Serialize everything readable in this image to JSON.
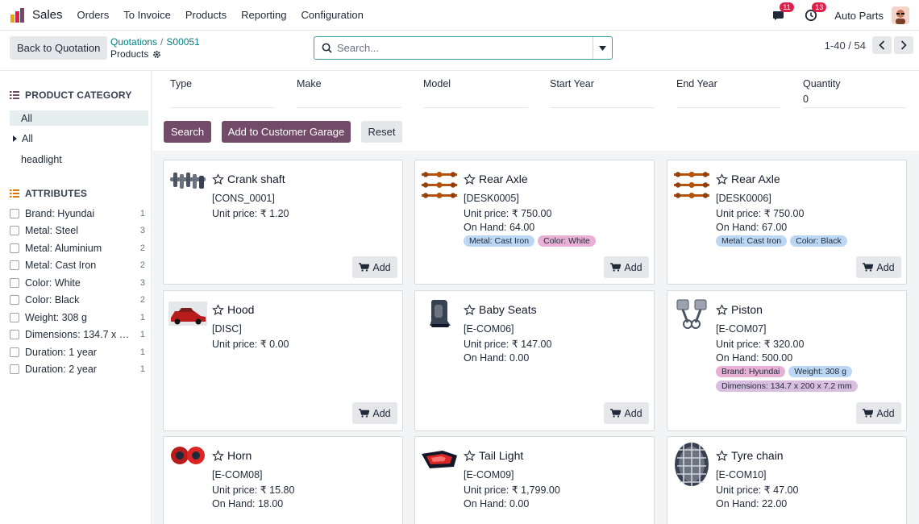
{
  "navbar": {
    "app_name": "Sales",
    "menu": [
      "Orders",
      "To Invoice",
      "Products",
      "Reporting",
      "Configuration"
    ],
    "messages_count": "11",
    "activities_count": "13",
    "company": "Auto Parts"
  },
  "control": {
    "back_label": "Back to Quotation",
    "breadcrumb_root": "Quotations",
    "breadcrumb_sep": "/",
    "breadcrumb_record": "S00051",
    "breadcrumb_current": "Products",
    "search_placeholder": "Search...",
    "pager": "1-40 / 54"
  },
  "sidebar": {
    "category_title": "PRODUCT CATEGORY",
    "categories": [
      "All",
      "All",
      "headlight"
    ],
    "attributes_title": "ATTRIBUTES",
    "attributes": [
      {
        "label": "Brand: Hyundai",
        "count": "1"
      },
      {
        "label": "Metal: Steel",
        "count": "3"
      },
      {
        "label": "Metal: Aluminium",
        "count": "2"
      },
      {
        "label": "Metal: Cast Iron",
        "count": "2"
      },
      {
        "label": "Color: White",
        "count": "3"
      },
      {
        "label": "Color: Black",
        "count": "2"
      },
      {
        "label": "Weight: 308 g",
        "count": "1"
      },
      {
        "label": "Dimensions: 134.7 x 200 x 7.2 mm",
        "count": "1"
      },
      {
        "label": "Duration: 1 year",
        "count": "1"
      },
      {
        "label": "Duration: 2 year",
        "count": "1"
      }
    ]
  },
  "filters": {
    "labels": [
      "Type",
      "Make",
      "Model",
      "Start Year",
      "End Year",
      "Quantity"
    ],
    "quantity_value": "0",
    "search_button": "Search",
    "garage_button": "Add to Customer Garage",
    "reset_button": "Reset"
  },
  "products": [
    {
      "name": "Crank shaft",
      "code": "[CONS_0001]",
      "price": "Unit price: ₹ 1.20",
      "onhand": "",
      "tags": [],
      "add": "Add"
    },
    {
      "name": "Rear Axle",
      "code": "[DESK0005]",
      "price": "Unit price: ₹ 750.00",
      "onhand": "On Hand: 64.00",
      "tags": [
        {
          "label": "Metal: Cast Iron",
          "color": "#bcd7f3"
        },
        {
          "label": "Color: White",
          "color": "#e9b0d6"
        }
      ],
      "add": "Add"
    },
    {
      "name": "Rear Axle",
      "code": "[DESK0006]",
      "price": "Unit price: ₹ 750.00",
      "onhand": "On Hand: 67.00",
      "tags": [
        {
          "label": "Metal: Cast Iron",
          "color": "#bcd7f3"
        },
        {
          "label": "Color: Black",
          "color": "#bcd7f3"
        }
      ],
      "add": "Add"
    },
    {
      "name": "Hood",
      "code": "[DISC]",
      "price": "Unit price: ₹ 0.00",
      "onhand": "",
      "tags": [],
      "add": "Add"
    },
    {
      "name": "Baby Seats",
      "code": "[E-COM06]",
      "price": "Unit price: ₹ 147.00",
      "onhand": "On Hand: 0.00",
      "tags": [],
      "add": "Add"
    },
    {
      "name": "Piston",
      "code": "[E-COM07]",
      "price": "Unit price: ₹ 320.00",
      "onhand": "On Hand: 500.00",
      "tags": [
        {
          "label": "Brand: Hyundai",
          "color": "#e9b0d6"
        },
        {
          "label": "Weight: 308 g",
          "color": "#bcd7f3"
        },
        {
          "label": "Dimensions: 134.7 x 200 x 7.2 mm",
          "color": "#d8bfe2"
        }
      ],
      "add": "Add"
    },
    {
      "name": "Horn",
      "code": "[E-COM08]",
      "price": "Unit price: ₹ 15.80",
      "onhand": "On Hand: 18.00",
      "tags": [],
      "add": "Add"
    },
    {
      "name": "Tail Light",
      "code": "[E-COM09]",
      "price": "Unit price: ₹ 1,799.00",
      "onhand": "On Hand: 0.00",
      "tags": [],
      "add": "Add"
    },
    {
      "name": "Tyre chain",
      "code": "[E-COM10]",
      "price": "Unit price: ₹ 47.00",
      "onhand": "On Hand: 22.00",
      "tags": [],
      "add": "Add"
    }
  ],
  "colors": {
    "brand": "#714b67",
    "accent": "#017e84",
    "badge": "#e11d48"
  }
}
